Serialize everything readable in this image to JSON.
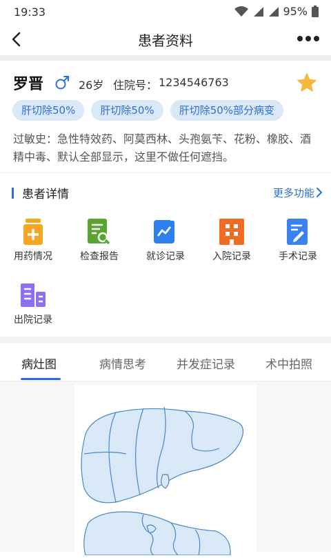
{
  "status": {
    "time": "19:33",
    "battery": "95%"
  },
  "nav": {
    "title": "患者资料"
  },
  "patient": {
    "name": "罗晋",
    "age": "26岁",
    "admission_label": "住院号：",
    "admission_no": "1234546763",
    "tags": [
      "肝切除50%",
      "肝切除50%",
      "肝切除50%部分病变"
    ],
    "allergy": "过敏史：急性特效药、阿莫西林、头孢氨苄、花粉、橡胶、酒精中毒、默认全部显示，这里不做任何遮挡。"
  },
  "details": {
    "title": "患者详情",
    "more": "更多功能",
    "items": [
      {
        "label": "用药情况",
        "icon": "medicine-icon",
        "color": "#f5a623"
      },
      {
        "label": "检查报告",
        "icon": "report-icon",
        "color": "#5aa52f"
      },
      {
        "label": "就诊记录",
        "icon": "visit-icon",
        "color": "#2d7ff0"
      },
      {
        "label": "入院记录",
        "icon": "building-icon",
        "color": "#f26b22"
      },
      {
        "label": "手术记录",
        "icon": "surgery-record-icon",
        "color": "#3a82f0"
      },
      {
        "label": "出院记录",
        "icon": "discharge-icon",
        "color": "#8e6ef0"
      }
    ]
  },
  "tabs": [
    {
      "label": "病灶图",
      "active": true
    },
    {
      "label": "病情思考",
      "active": false
    },
    {
      "label": "并发症记录",
      "active": false
    },
    {
      "label": "术中拍照",
      "active": false
    }
  ],
  "colors": {
    "accent": "#2d6fd6",
    "tag_bg": "#dbe8f7",
    "star": "#f6b73c"
  }
}
